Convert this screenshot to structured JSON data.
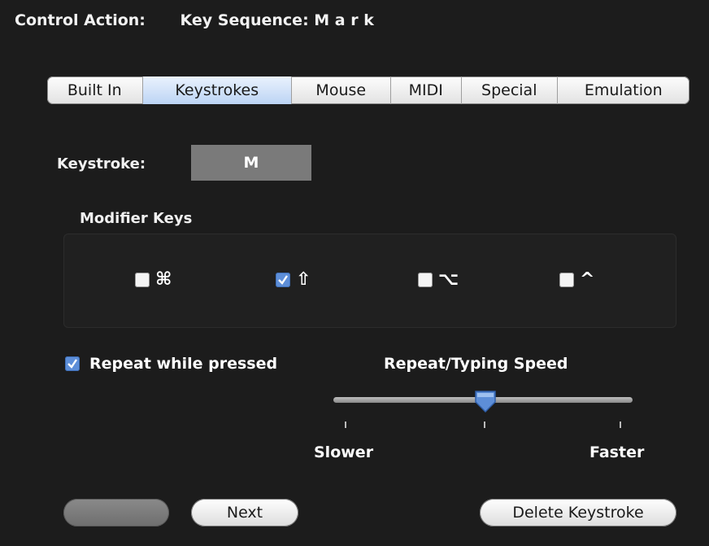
{
  "header": {
    "control_action_label": "Control Action:",
    "sequence_label": "Key Sequence: M a r k"
  },
  "tabs": [
    {
      "label": "Built In"
    },
    {
      "label": "Keystrokes",
      "active": true
    },
    {
      "label": "Mouse"
    },
    {
      "label": "MIDI"
    },
    {
      "label": "Special"
    },
    {
      "label": "Emulation"
    }
  ],
  "keystroke": {
    "label": "Keystroke:",
    "value": "M"
  },
  "modifiers": {
    "title": "Modifier Keys",
    "keys": [
      {
        "symbol": "⌘",
        "checked": false
      },
      {
        "symbol": "⇧",
        "checked": true
      },
      {
        "symbol": "⌥",
        "checked": false
      },
      {
        "symbol": "^",
        "checked": false
      }
    ]
  },
  "repeat": {
    "label": "Repeat while pressed",
    "checked": true
  },
  "speed": {
    "title": "Repeat/Typing Speed",
    "min_label": "Slower",
    "max_label": "Faster",
    "value": 0.5
  },
  "buttons": {
    "previous_label": "",
    "next_label": "Next",
    "delete_label": "Delete Keystroke"
  },
  "colors": {
    "accent": "#5d8ed8",
    "active_tab": "#bcd4f4",
    "background": "#1c1c1c"
  }
}
